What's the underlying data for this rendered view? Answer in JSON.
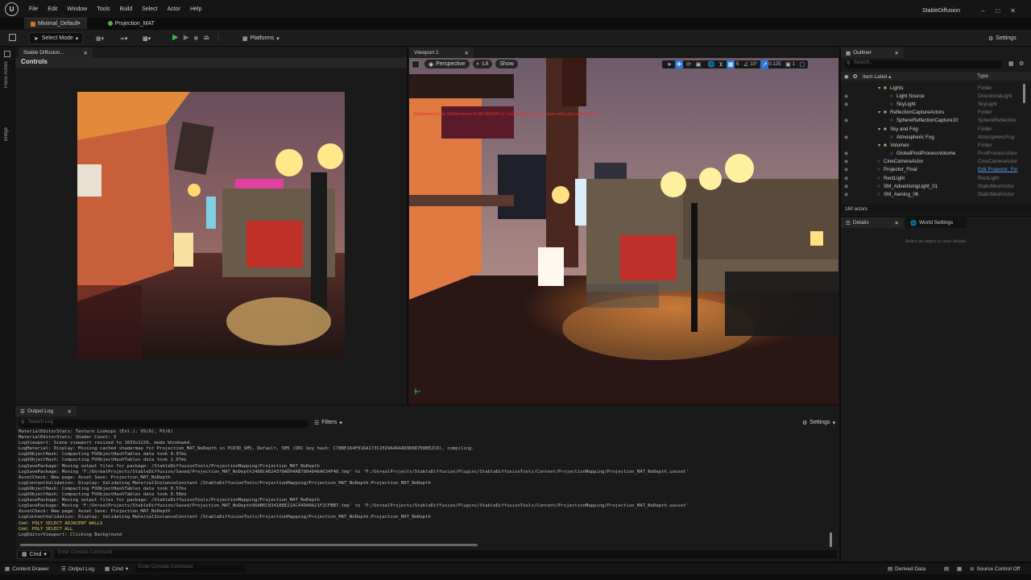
{
  "app": {
    "title": "StableDiffusion",
    "logo": "unreal-logo"
  },
  "menu": [
    "File",
    "Edit",
    "Window",
    "Tools",
    "Build",
    "Select",
    "Actor",
    "Help"
  ],
  "doc_tabs": [
    "Minimal_Default•",
    "Projection_MAT"
  ],
  "toolbar": {
    "select_mode": "Select Mode",
    "platforms": "Platforms",
    "settings": "Settings"
  },
  "sidebar": {
    "place_actors": "Place Actors",
    "bridge": "Bridge"
  },
  "left_panel": {
    "tab": "Stable Diffusion...",
    "header": "Controls",
    "image_label": "generated-image"
  },
  "viewport": {
    "tab": "Viewport 1",
    "perspective": "Perspective",
    "lit": "Lit",
    "show": "Show",
    "warning": "Volumetric(s) has unlit/emissive hi bits (MSAA=1) / unchanged. Expect issues with pixel art/overlays",
    "snap_angle": "10°",
    "snap_scale": "0.125",
    "cam_speed": "1",
    "grid": "5"
  },
  "outliner": {
    "tab": "Outliner",
    "search_placeholder": "Search...",
    "col_label": "Item Label ▴",
    "col_type": "Type",
    "rows": [
      {
        "name": "Lights",
        "type": "Folder",
        "indent": 1,
        "kind": "folder"
      },
      {
        "name": "Light Source",
        "type": "DirectionalLight",
        "indent": 2,
        "kind": "actor"
      },
      {
        "name": "SkyLight",
        "type": "SkyLight",
        "indent": 2,
        "kind": "actor"
      },
      {
        "name": "ReflectionCaptureActors",
        "type": "Folder",
        "indent": 1,
        "kind": "folder"
      },
      {
        "name": "SphereReflectionCapture10",
        "type": "SphereReflection",
        "indent": 2,
        "kind": "actor"
      },
      {
        "name": "Sky and Fog",
        "type": "Folder",
        "indent": 1,
        "kind": "folder"
      },
      {
        "name": "Atmospheric Fog",
        "type": "AtmosphericFog",
        "indent": 2,
        "kind": "actor"
      },
      {
        "name": "Volumes",
        "type": "Folder",
        "indent": 1,
        "kind": "folder"
      },
      {
        "name": "GlobalPostProcessVolume",
        "type": "PostProcessVolur",
        "indent": 2,
        "kind": "actor"
      },
      {
        "name": "CineCameraActor",
        "type": "CineCameraActor",
        "indent": 0,
        "kind": "actor"
      },
      {
        "name": "Projector_Final",
        "type": "Edit Projector_Fin",
        "indent": 0,
        "kind": "actor",
        "link": true
      },
      {
        "name": "RectLight",
        "type": "RectLight",
        "indent": 0,
        "kind": "actor"
      },
      {
        "name": "SM_AdvertisingLight_01",
        "type": "StaticMeshActor",
        "indent": 0,
        "kind": "actor"
      },
      {
        "name": "SM_Awning_06",
        "type": "StaticMeshActor",
        "indent": 0,
        "kind": "actor"
      }
    ],
    "count": "160 actors"
  },
  "details": {
    "tab": "Details",
    "world_tab": "World Settings",
    "empty": "Select an object to view details."
  },
  "output_log": {
    "tab": "Output Log",
    "search_placeholder": "Search Log",
    "filters": "Filters",
    "settings": "Settings",
    "lines": [
      {
        "t": "MaterialEditorStats: Texture Lookups (Est.): VS(0), PS(6)",
        "y": false
      },
      {
        "t": "MaterialEditorStats: Shader Count: 3",
        "y": false
      },
      {
        "t": "LogViewport: Scene viewport resized to 1033x1229, mode Windowed.",
        "y": false
      },
      {
        "t": "LogMaterial: Display: Missing cached shadermap for Projection_MAT_NoDepth in PCD3D_SM5, Default, SM5 (DDC key hash: C78BE164F016A173C2029A464AD9D887E8BE2CD), compiling.",
        "y": false
      },
      {
        "t": "LogUObjectHash: Compacting FUObjectHashTables data took   9.97ms",
        "y": false
      },
      {
        "t": "LogUObjectHash: Compacting FUObjectHashTables data took   2.07ms",
        "y": false
      },
      {
        "t": "LogSavePackage: Moving output files for package: /StableDiffusionTools/ProjectionMapping/Projection_MAT_NoDepth",
        "y": false
      },
      {
        "t": "LogSavePackage: Moving 'F:/UnrealProjects/StableDiffusion/Saved/Projection_MAT_NoDepth2408C4824370AD94AB7804846A634F48.tmp' to 'F:/UnrealProjects/StableDiffusion/Plugins/StableDiffusionTools/Content/ProjectionMapping/Projection_MAT_NoDepth.uasset'",
        "y": false
      },
      {
        "t": "AssetCheck: New page: Asset Save: Projection_MAT_NoDepth",
        "y": false
      },
      {
        "t": "LogContentValidation: Display: Validating MaterialInstanceConstant /StableDiffusionTools/ProjectionMapping/Projection_MAT_NoDepth.Projection_MAT_NoDepth",
        "y": false
      },
      {
        "t": "LogUObjectHash: Compacting FUObjectHashTables data took   0.57ms",
        "y": false
      },
      {
        "t": "LogUObjectHash: Compacting FUObjectHashTables data took   0.56ms",
        "y": false
      },
      {
        "t": "LogSavePackage: Moving output files for package: /StableDiffusionTools/ProjectionMapping/Projection_MAT_NoDepth",
        "y": false
      },
      {
        "t": "LogSavePackage: Moving 'F:/UnrealProjects/StableDiffusion/Saved/Projection_MAT_NoDepth96AB6C8341B8E21AC44DA0A21F2CFBB7.tmp' to 'F:/UnrealProjects/StableDiffusion/Plugins/StableDiffusionTools/Content/ProjectionMapping/Projection_MAT_NoDepth.uasset'",
        "y": false
      },
      {
        "t": "AssetCheck: New page: Asset Save: Projection_MAT_NoDepth",
        "y": false
      },
      {
        "t": "LogContentValidation: Display: Validating MaterialInstanceConstant /StableDiffusionTools/ProjectionMapping/Projection_MAT_NoDepth.Projection_MAT_NoDepth",
        "y": false
      },
      {
        "t": "Cmd: POLY SELECT ADJACENT WALLS",
        "y": true
      },
      {
        "t": "Cmd: POLY SELECT ALL",
        "y": true
      },
      {
        "t": "LogEditorViewport: Clicking Background",
        "y": false
      }
    ],
    "cmd_label": "Cmd",
    "console_placeholder": "Enter Console Command"
  },
  "bottom": {
    "content_drawer": "Content Drawer",
    "output_log": "Output Log",
    "cmd": "Cmd",
    "console_placeholder": "Enter Console Command",
    "derived_data": "Derived Data",
    "source_control": "Source Control Off"
  },
  "colors": {
    "accent": "#2a78d6",
    "play": "#3fb04a",
    "warning": "#d93a3a",
    "folder": "#c9a860"
  }
}
